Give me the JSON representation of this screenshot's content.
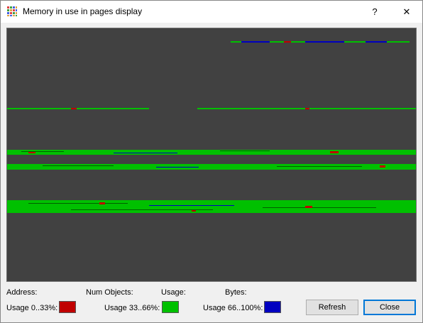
{
  "window": {
    "title": "Memory in use in pages display",
    "help_glyph": "?",
    "close_glyph": "✕"
  },
  "legend": {
    "headings": [
      "Address:",
      "Num Objects:",
      "Usage:",
      "Bytes:"
    ],
    "low": {
      "label": "Usage 0..33%:",
      "color": "#c00000"
    },
    "mid": {
      "label": "Usage 33..66%:",
      "color": "#00c000"
    },
    "high": {
      "label": "Usage 66..100%:",
      "color": "#0000c0"
    }
  },
  "buttons": {
    "refresh": "Refresh",
    "close": "Close"
  },
  "display_colors": {
    "background": "#414141",
    "red": "#c00000",
    "green": "#00c000",
    "blue": "#0000c0"
  }
}
